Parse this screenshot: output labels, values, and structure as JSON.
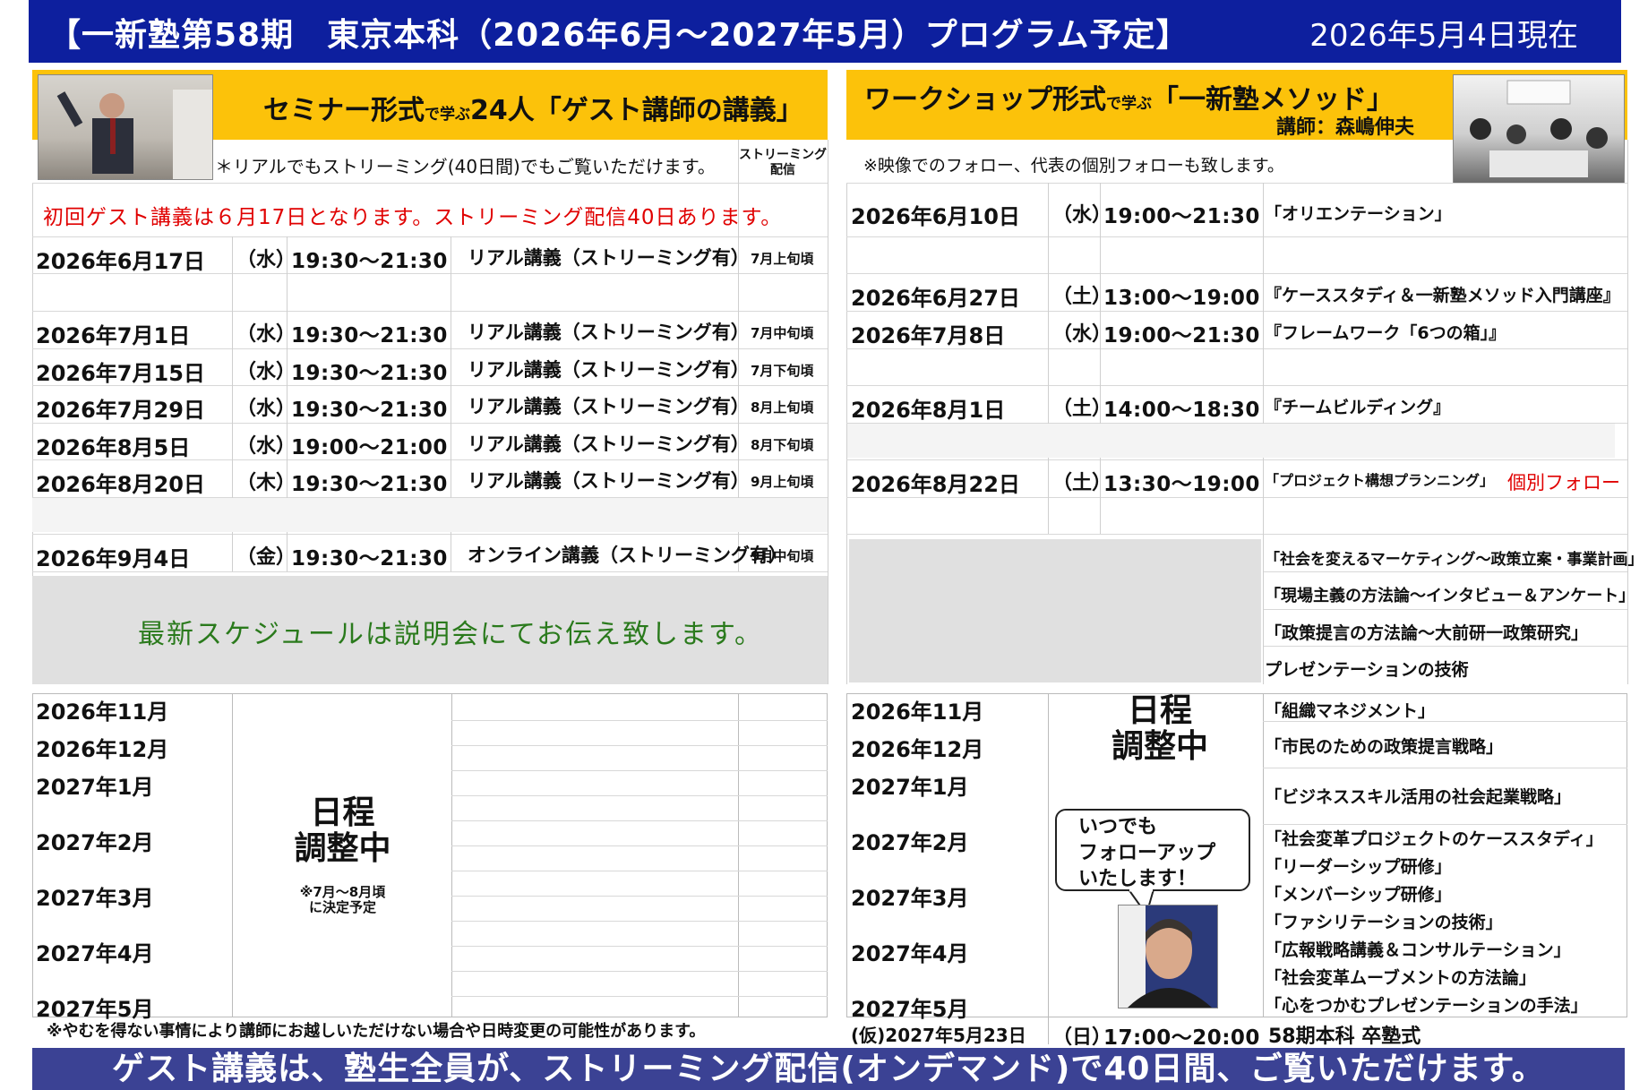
{
  "title": "【一新塾第58期　東京本科（2026年6月～2027年5月）プログラム予定】",
  "as_of": "2026年5月4日現在",
  "left": {
    "header_main1": "セミナー形式",
    "header_small": "で学ぶ",
    "header_main2": "24人「ゲスト講師の講義」",
    "note": "＊リアルでもストリーミング(40日間)でもご覧いただけます。",
    "stream_col": "ストリーミング\n配信",
    "first_notice": "初回ゲスト講義は６月17日となります。ストリーミング配信40日あります。",
    "rows": [
      {
        "date": "2026年6月17日",
        "dow": "（水）",
        "time": "19:30～21:30",
        "kind": "リアル講義（ストリーミング有）",
        "stream": "7月上旬頃"
      },
      {
        "date": "2026年7月1日",
        "dow": "（水）",
        "time": "19:30～21:30",
        "kind": "リアル講義（ストリーミング有）",
        "stream": "7月中旬頃"
      },
      {
        "date": "2026年7月15日",
        "dow": "（水）",
        "time": "19:30～21:30",
        "kind": "リアル講義（ストリーミング有）",
        "stream": "7月下旬頃"
      },
      {
        "date": "2026年7月29日",
        "dow": "（水）",
        "time": "19:30～21:30",
        "kind": "リアル講義（ストリーミング有）",
        "stream": "8月上旬頃"
      },
      {
        "date": "2026年8月5日",
        "dow": "（水）",
        "time": "19:00～21:00",
        "kind": "リアル講義（ストリーミング有）",
        "stream": "8月下旬頃"
      },
      {
        "date": "2026年8月20日",
        "dow": "（木）",
        "time": "19:30～21:30",
        "kind": "リアル講義（ストリーミング有）",
        "stream": "9月上旬頃"
      },
      {
        "date": "2026年9月4日",
        "dow": "（金）",
        "time": "19:30～21:30",
        "kind": "オンライン講義（ストリーミング有）",
        "stream": "9月中旬頃"
      }
    ],
    "schedule_notice": "最新スケジュールは説明会にてお伝え致します。",
    "months": [
      "2026年11月",
      "2026年12月",
      "2027年1月",
      "2027年2月",
      "2027年3月",
      "2027年4月",
      "2027年5月"
    ],
    "adjusting": "日程\n調整中",
    "decide_note": "※7月～8月頃\nに決定予定",
    "disclaimer": "※やむを得ない事情により講師にお越しいただけない場合や日時変更の可能性があります。"
  },
  "right": {
    "header_main1": "ワークショップ形式",
    "header_small": "で学ぶ",
    "header_main2": "「一新塾メソッド」",
    "instructor": "講師：森嶋伸夫",
    "note": "※映像でのフォロー、代表の個別フォローも致します。",
    "rows": [
      {
        "date": "2026年6月10日",
        "dow": "（水）",
        "time": "19:00～21:30",
        "topic": "「オリエンテーション」"
      },
      {
        "date": "2026年6月27日",
        "dow": "（土）",
        "time": "13:00～19:00",
        "topic": "『ケーススタディ＆一新塾メソッド入門講座』"
      },
      {
        "date": "2026年7月8日",
        "dow": "（水）",
        "time": "19:00～21:30",
        "topic": "『フレームワーク「6つの箱」』"
      },
      {
        "date": "2026年8月1日",
        "dow": "（土）",
        "time": "14:00～18:30",
        "topic": "『チームビルディング』"
      },
      {
        "date": "2026年8月22日",
        "dow": "（土）",
        "time": "13:30～19:00",
        "topic": "「プロジェクト構想プランニング」"
      }
    ],
    "individual_follow": "個別フォロー",
    "topics_mid": [
      "「社会を変えるマーケティング～政策立案・事業計画」",
      "「現場主義の方法論～インタビュー＆アンケート」",
      "「政策提言の方法論～大前研一政策研究」",
      "プレゼンテーションの技術"
    ],
    "months": [
      "2026年11月",
      "2026年12月",
      "2027年1月",
      "2027年2月",
      "2027年3月",
      "2027年4月",
      "2027年5月"
    ],
    "adjusting": "日程\n調整中",
    "topics_late": [
      "「組織マネジメント」",
      "「市民のための政策提言戦略」",
      "「ビジネススキル活用の社会起業戦略」",
      "「社会変革プロジェクトのケーススタディ」",
      "「リーダーシップ研修」",
      "「メンバーシップ研修」",
      "「ファシリテーションの技術」",
      "「広報戦略講義＆コンサルテーション」",
      "「社会変革ムーブメントの方法論」",
      "「心をつかむプレゼンテーションの手法」"
    ],
    "bubble": "いつでも\nフォローアップ\nいたします！",
    "graduation": {
      "date": "(仮)2027年5月23日",
      "dow": "（日）",
      "time": "17:00～20:00",
      "label": "58期本科 卒塾式"
    }
  },
  "footer": "ゲスト講義は、塾生全員が、ストリーミング配信(オンデマンド)で40日間、ご覧いただけます。",
  "colors": {
    "title_bg": "#0d1f9e",
    "header_bg": "#fcc20a",
    "footer_bg": "#3b4294",
    "alert": "#e00000",
    "notice": "#2a7a1c"
  }
}
